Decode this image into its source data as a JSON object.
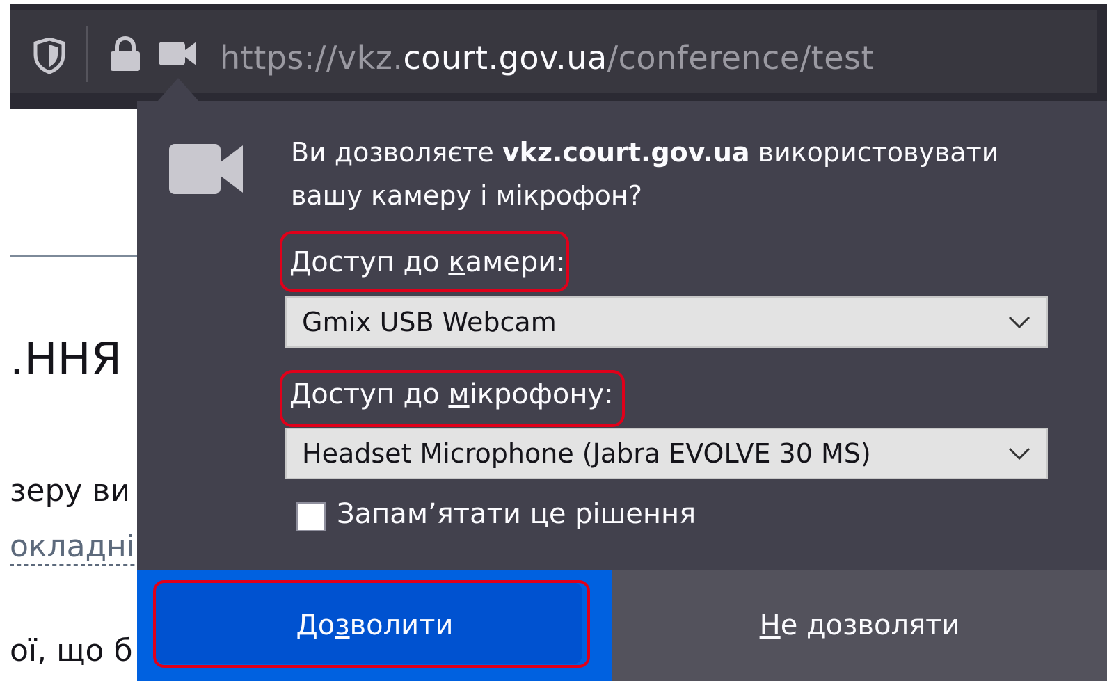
{
  "toolbar": {
    "url_prefix": "https://vkz.",
    "url_domain": "court.gov.ua",
    "url_path": "/conference/test"
  },
  "page": {
    "heading_fragment": ".ННЯ",
    "text1_fragment": "зеру ви",
    "link_fragment": "окладніц",
    "text2_fragment": "ої, що б"
  },
  "prompt": {
    "message_before": "Ви дозволяєте ",
    "message_host": "vkz.court.gov.ua",
    "message_after": " використовувати вашу камеру і мікрофон?",
    "camera_label_pre": "Доступ до ",
    "camera_label_key": "к",
    "camera_label_post": "амери:",
    "camera_value": "Gmix  USB Webcam",
    "mic_label_pre": "Доступ до ",
    "mic_label_key": "м",
    "mic_label_post": "ікрофону:",
    "mic_value": "Headset Microphone (Jabra EVOLVE 30 MS)",
    "remember_label": "Запам’ятати це рішення",
    "allow_pre": "До",
    "allow_key": "з",
    "allow_post": "волити",
    "deny_key": "Н",
    "deny_post": "е дозволяти"
  },
  "colors": {
    "highlight": "#e0001a",
    "allow_bg": "#0061e0",
    "panel_bg": "#42414d"
  }
}
